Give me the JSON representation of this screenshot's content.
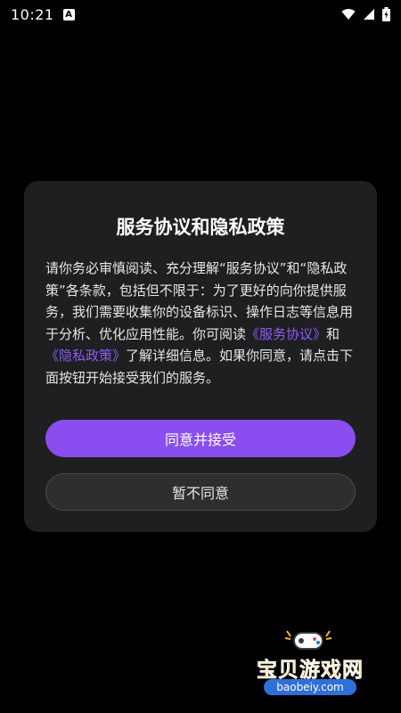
{
  "status_bar": {
    "time": "10:21",
    "notification_badge": "A",
    "icons": [
      "wifi-icon",
      "signal-icon",
      "battery-icon"
    ]
  },
  "dialog": {
    "title": "服务协议和隐私政策",
    "body": {
      "part1": "请你务必审慎阅读、充分理解“服务协议”和“隐私政策”各条款，包括但不限于：为了更好的向你提供服务，我们需要收集你的设备标识、操作日志等信息用于分析、优化应用性能。你可阅读",
      "link_service": "《服务协议》",
      "part2": "和",
      "link_privacy": "《隐私政策》",
      "part3": "了解详细信息。如果你同意，请点击下面按钮开始接受我们的服务。"
    },
    "agree_label": "同意并接受",
    "decline_label": "暂不同意"
  },
  "watermark": {
    "title": "宝贝游戏网",
    "url": "baobeiy.com"
  },
  "colors": {
    "background": "#000000",
    "dialog_bg": "#1f1f21",
    "accent": "#8a4df0",
    "link": "#8a5cf5"
  }
}
